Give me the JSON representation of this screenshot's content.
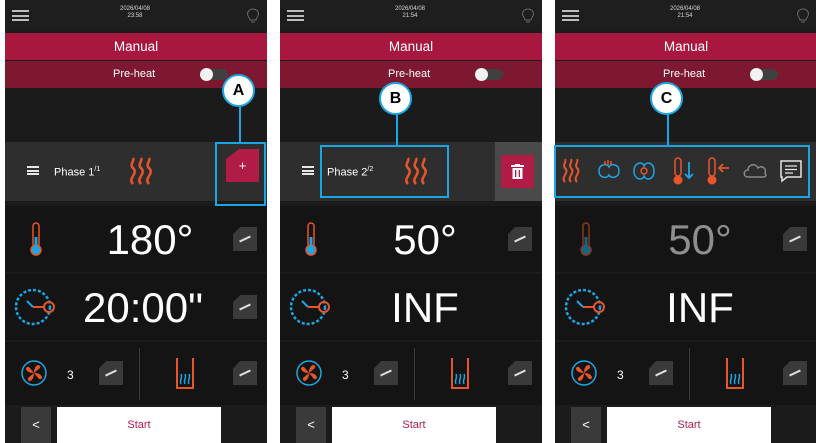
{
  "colors": {
    "accent": "#b01c46",
    "title_bar": "#a8183e",
    "preheat_bar": "#7e1830",
    "highlight": "#1aa6e4",
    "icon_orange": "#e8552a",
    "icon_blue": "#1aa6e4"
  },
  "screens": [
    {
      "datetime_date": "2026/04/08",
      "datetime_time": "23:58",
      "title": "Manual",
      "preheat_label": "Pre-heat",
      "phase_label": "Phase 1",
      "phase_sup": "/1",
      "phase_action_label": "+",
      "temperature": "180°",
      "time": "20:00\"",
      "fan_speed": "3",
      "back_label": "<",
      "start_label": "Start",
      "callout": "A"
    },
    {
      "datetime_date": "2026/04/08",
      "datetime_time": "21:54",
      "title": "Manual",
      "preheat_label": "Pre-heat",
      "phase_label": "Phase 2",
      "phase_sup": "/2",
      "temperature": "50°",
      "time": "INF",
      "fan_speed": "3",
      "back_label": "<",
      "start_label": "Start",
      "callout": "B"
    },
    {
      "datetime_date": "2026/04/08",
      "datetime_time": "21:54",
      "title": "Manual",
      "preheat_label": "Pre-heat",
      "temperature": "50°",
      "time": "INF",
      "fan_speed": "3",
      "back_label": "<",
      "start_label": "Start",
      "callout": "C",
      "tool_icons": [
        "heat-waves-icon",
        "fan-hand-icon",
        "fan-icon",
        "temp-down-icon",
        "temp-left-icon",
        "cloud-icon",
        "message-icon"
      ]
    }
  ]
}
